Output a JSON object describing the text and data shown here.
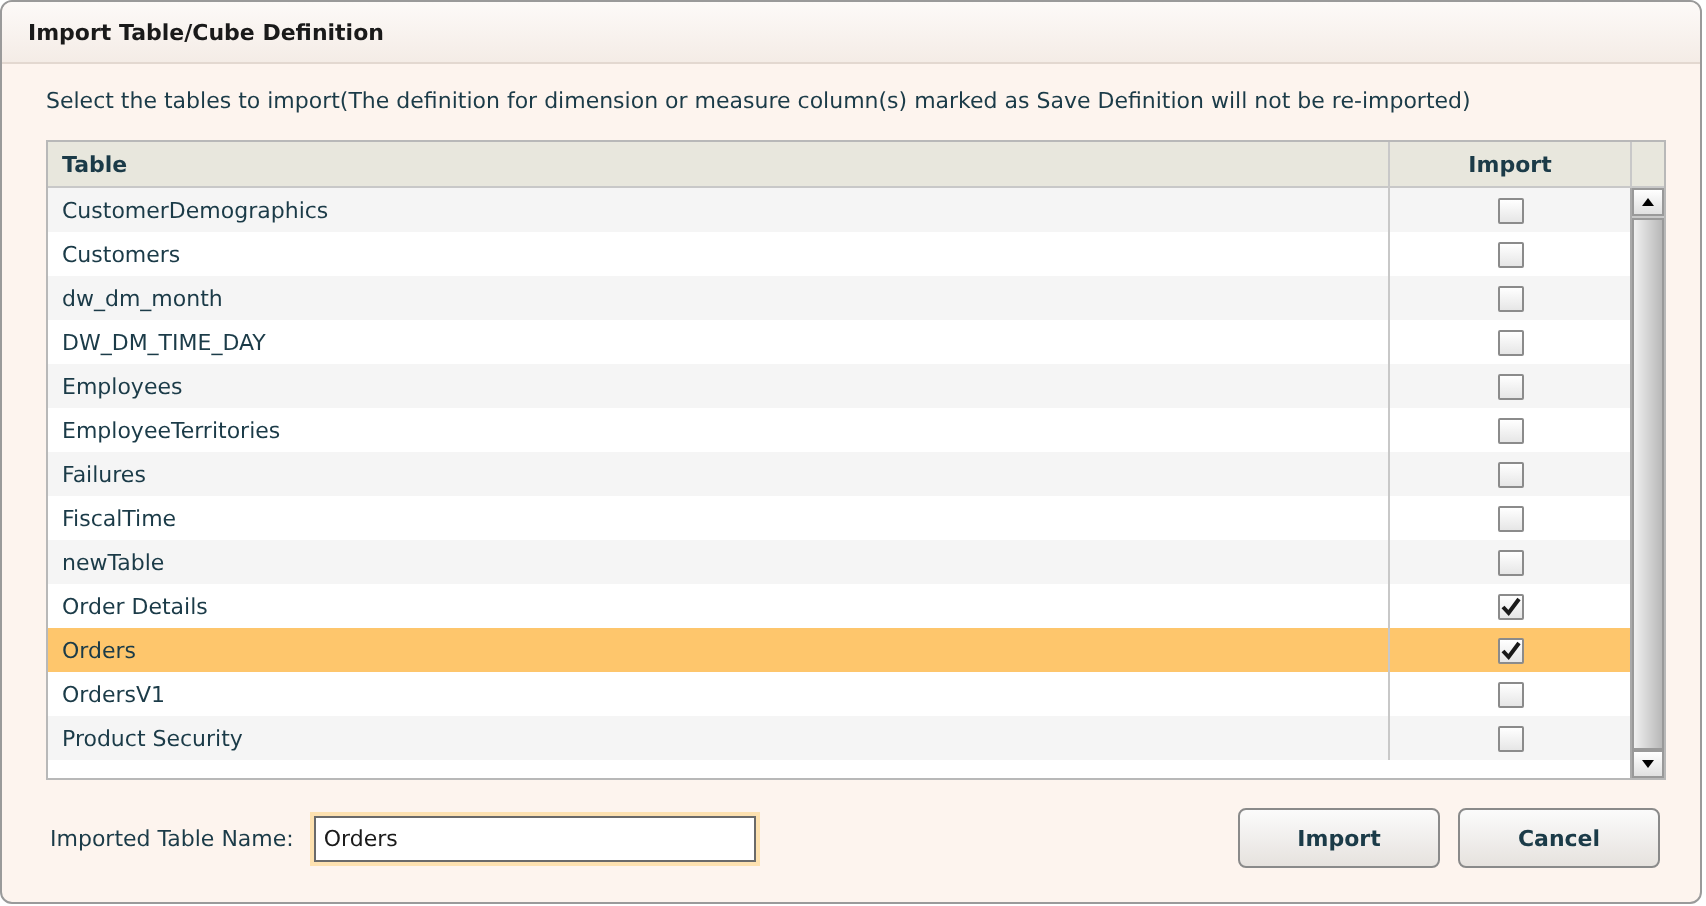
{
  "window": {
    "title": "Import Table/Cube Definition"
  },
  "instruction": "Select the tables to import(The definition for dimension or measure column(s) marked as Save Definition will not be re-imported)",
  "table": {
    "columns": [
      "Table",
      "Import"
    ],
    "rows": [
      {
        "name": "CustomerDemographics",
        "checked": false,
        "selected": false
      },
      {
        "name": "Customers",
        "checked": false,
        "selected": false
      },
      {
        "name": "dw_dm_month",
        "checked": false,
        "selected": false
      },
      {
        "name": "DW_DM_TIME_DAY",
        "checked": false,
        "selected": false
      },
      {
        "name": "Employees",
        "checked": false,
        "selected": false
      },
      {
        "name": "EmployeeTerritories",
        "checked": false,
        "selected": false
      },
      {
        "name": "Failures",
        "checked": false,
        "selected": false
      },
      {
        "name": "FiscalTime",
        "checked": false,
        "selected": false
      },
      {
        "name": "newTable",
        "checked": false,
        "selected": false
      },
      {
        "name": "Order Details",
        "checked": true,
        "selected": false
      },
      {
        "name": "Orders",
        "checked": true,
        "selected": true
      },
      {
        "name": "OrdersV1",
        "checked": false,
        "selected": false
      },
      {
        "name": "Product Security",
        "checked": false,
        "selected": false
      }
    ]
  },
  "imported_table_name": {
    "label": "Imported Table Name:",
    "value": "Orders"
  },
  "buttons": [
    "Import",
    "Cancel"
  ]
}
